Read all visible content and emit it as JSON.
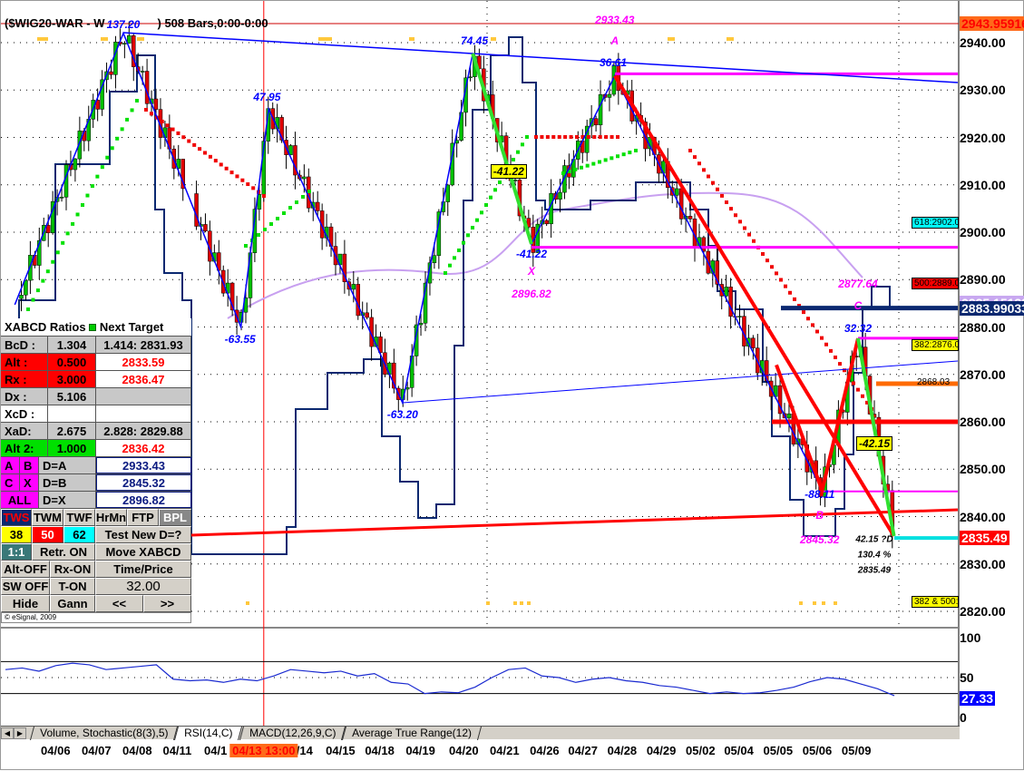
{
  "header": {
    "title_left": "($WIG20-WAR - W",
    "title_right": ") 508 Bars,0:00-0:00"
  },
  "price_axis": {
    "ticks": [
      "2940.00",
      "2930.00",
      "2920.00",
      "2910.00",
      "2900.00",
      "2890.00",
      "2880.00",
      "2870.00",
      "2860.00",
      "2850.00",
      "2840.00",
      "2830.00",
      "2820.00"
    ],
    "tags": [
      {
        "text": "2943.95916",
        "price": 2943.96,
        "bg": "#ff6a1a",
        "fg": "#ff0000"
      },
      {
        "text": "2885.15183",
        "price": 2885.15,
        "bg": "#c8a8f0",
        "fg": "#ffffff"
      },
      {
        "text": "2883.99033",
        "price": 2883.99,
        "bg": "#0a2870",
        "fg": "#ffffff"
      },
      {
        "text": "2835.49",
        "price": 2835.49,
        "bg": "#ff0000",
        "fg": "#ffffff"
      }
    ]
  },
  "rsi_axis": {
    "ticks": [
      "100",
      "50",
      "0"
    ],
    "value_tag": "27.33",
    "color": "#0000ff"
  },
  "right_tags": [
    {
      "text": "618:2902.0",
      "price": 2902,
      "bg": "#00ffff"
    },
    {
      "text": "500:2889.0",
      "price": 2889,
      "bg": "#ff0000"
    },
    {
      "text": "382:2876.0",
      "price": 2876,
      "bg": "#ffff00"
    },
    {
      "text": "382 & 500:",
      "price": 2822,
      "bg": "#ffff00"
    }
  ],
  "line_label": {
    "text": "2868.03",
    "price": 2868.03
  },
  "chart_labels": [
    {
      "text": "137.20",
      "bar": 15,
      "price": 2943.8,
      "color": "#0000ff"
    },
    {
      "text": "74.45",
      "bar": 58,
      "price": 2940.3,
      "color": "#0000ff"
    },
    {
      "text": "36.61",
      "bar": 75,
      "price": 2935.8,
      "color": "#0000ff"
    },
    {
      "text": "47.95",
      "bar": 32.6,
      "price": 2928.5,
      "color": "#0000ff"
    },
    {
      "text": "-63.55",
      "bar": 29.3,
      "price": 2877.5,
      "color": "#0000ff"
    },
    {
      "text": "-63.20",
      "bar": 49.2,
      "price": 2861.5,
      "color": "#0000ff"
    },
    {
      "text": "-41.22",
      "bar": 65,
      "price": 2895.5,
      "color": "#0000ff"
    },
    {
      "text": "2933.43",
      "bar": 75.2,
      "price": 2944.8,
      "color": "#ff00ff"
    },
    {
      "text": "A",
      "bar": 75.2,
      "price": 2940.3,
      "color": "#ff00ff"
    },
    {
      "text": "X",
      "bar": 65,
      "price": 2891.8,
      "color": "#ff00ff"
    },
    {
      "text": "2896.82",
      "bar": 65,
      "price": 2887,
      "color": "#ff00ff"
    },
    {
      "text": "2877.64",
      "bar": 105,
      "price": 2889,
      "color": "#ff00ff"
    },
    {
      "text": "C",
      "bar": 105,
      "price": 2884.5,
      "color": "#ff00ff"
    },
    {
      "text": "32.32",
      "bar": 105,
      "price": 2879.7,
      "color": "#0000ff"
    },
    {
      "text": "-88.11",
      "bar": 100.3,
      "price": 2844.7,
      "color": "#0000ff"
    },
    {
      "text": "B",
      "bar": 100.3,
      "price": 2840.2,
      "color": "#ff00ff"
    },
    {
      "text": "2845.32",
      "bar": 100.3,
      "price": 2835.2,
      "color": "#ff00ff"
    },
    {
      "text": "42.15 ?D",
      "bar": 107,
      "price": 2835.2,
      "color": "#000000"
    },
    {
      "text": "130.4 %",
      "bar": 107,
      "price": 2831.8,
      "color": "#000000"
    },
    {
      "text": "2835.49",
      "bar": 107,
      "price": 2828.7,
      "color": "#000000"
    }
  ],
  "boxed_labels": [
    {
      "text": "-41.22",
      "bar": 62.2,
      "price": 2912.8
    },
    {
      "text": "-42.15",
      "bar": 107,
      "price": 2855.5
    }
  ],
  "panel": {
    "title": "XABCD Ratios",
    "next_target": "Next Target",
    "rows": [
      {
        "k": "BcD :",
        "v": "1.304",
        "t": "1.414: 2831.93",
        "style": "gray",
        "tcolor": "#000"
      },
      {
        "k": "Alt  :",
        "v": "0.500",
        "t": "2833.59",
        "style": "red",
        "tcolor": "#f00"
      },
      {
        "k": "Rx  :",
        "v": "3.000",
        "t": "2836.47",
        "style": "red",
        "tcolor": "#f00"
      },
      {
        "k": "Dx  :",
        "v": "5.106",
        "t": "",
        "style": "gray",
        "tcolor": "#000"
      },
      {
        "k": "XcD :",
        "v": "",
        "t": "",
        "style": "white",
        "tcolor": "#000"
      },
      {
        "k": "XaD:",
        "v": "2.675",
        "t": "2.828: 2829.88",
        "style": "gray",
        "tcolor": "#000"
      },
      {
        "k": "Alt 2:",
        "v": "1.000",
        "t": "2836.42",
        "style": "green",
        "tcolor": "#f00"
      }
    ],
    "point_rows": [
      {
        "a": "A",
        "b": "B",
        "d": "D=A",
        "t": "2933.43"
      },
      {
        "a": "C",
        "b": "X",
        "d": "D=B",
        "t": "2845.32"
      },
      {
        "a": "ALL",
        "b": "",
        "d": "D=X",
        "t": "2896.82"
      }
    ],
    "buttons": {
      "tws": "TWS",
      "twm": "TWM",
      "twf": "TWF",
      "hrmn": "HrMn",
      "ftp": "FTP",
      "bpl": "BPL",
      "b38": "38",
      "b50": "50",
      "b62": "62",
      "test": "Test New D=?",
      "r11": "1:1",
      "retr": "Retr. ON",
      "move": "Move XABCD",
      "alt": "Alt-OFF",
      "rx": "Rx-ON",
      "tp": "Time/Price",
      "sw": "SW OFF",
      "ton": "T-ON",
      "value": "32.00",
      "hide": "Hide",
      "gann": "Gann",
      "prev": "<<",
      "next": ">>"
    },
    "copyright": "© eSignal, 2009"
  },
  "tabs": [
    "Volume, Stochastic(8(3),5)",
    "RSI(14,C)",
    "MACD(12,26,9,C)",
    "Average True Range(12)"
  ],
  "active_tab": 1,
  "dates": [
    {
      "t": "04/06",
      "bar": 6.7
    },
    {
      "t": "04/07",
      "bar": 11.7
    },
    {
      "t": "04/08",
      "bar": 16.7
    },
    {
      "t": "04/11",
      "bar": 21.6
    },
    {
      "t": "04/1",
      "bar": 26.3
    },
    {
      "t": "/14",
      "bar": 37.2
    },
    {
      "t": "04/15",
      "bar": 41.6
    },
    {
      "t": "04/18",
      "bar": 46.4
    },
    {
      "t": "04/19",
      "bar": 51.4
    },
    {
      "t": "04/20",
      "bar": 56.7
    },
    {
      "t": "04/21",
      "bar": 61.7
    },
    {
      "t": "04/26",
      "bar": 66.6
    },
    {
      "t": "04/27",
      "bar": 71.3
    },
    {
      "t": "04/28",
      "bar": 76.1
    },
    {
      "t": "04/29",
      "bar": 80.9
    },
    {
      "t": "05/02",
      "bar": 85.7
    },
    {
      "t": "05/04",
      "bar": 90.4
    },
    {
      "t": "05/05",
      "bar": 95.2
    },
    {
      "t": "05/06",
      "bar": 100
    },
    {
      "t": "05/09",
      "bar": 104.8
    }
  ],
  "cursor": {
    "label": "04/13 13:00",
    "bar": 32.2
  },
  "chart_data": {
    "type": "line",
    "title": "$WIG20-WAR",
    "ylim": [
      2818,
      2946
    ],
    "zigzag": [
      [
        1.7,
        2884.7
      ],
      [
        15,
        2942
      ],
      [
        29.4,
        2880
      ],
      [
        32.8,
        2926
      ],
      [
        49.2,
        2864
      ],
      [
        57.8,
        2937.7
      ],
      [
        65,
        2897.5
      ],
      [
        75.2,
        2933
      ],
      [
        100.6,
        2845.5
      ],
      [
        105,
        2877.6
      ],
      [
        109.4,
        2835.9
      ]
    ],
    "rsi": [
      60,
      62,
      58,
      65,
      68,
      66,
      60,
      62,
      64,
      66,
      48,
      46,
      47,
      44,
      48,
      46,
      52,
      60,
      58,
      56,
      58,
      52,
      55,
      44,
      42,
      30,
      32,
      31,
      38,
      50,
      60,
      62,
      52,
      50,
      44,
      48,
      50,
      46,
      44,
      40,
      38,
      34,
      30,
      32,
      30,
      31,
      34,
      38,
      45,
      50,
      48,
      42,
      36,
      27.33
    ],
    "rsi_levels": [
      70,
      30
    ]
  }
}
